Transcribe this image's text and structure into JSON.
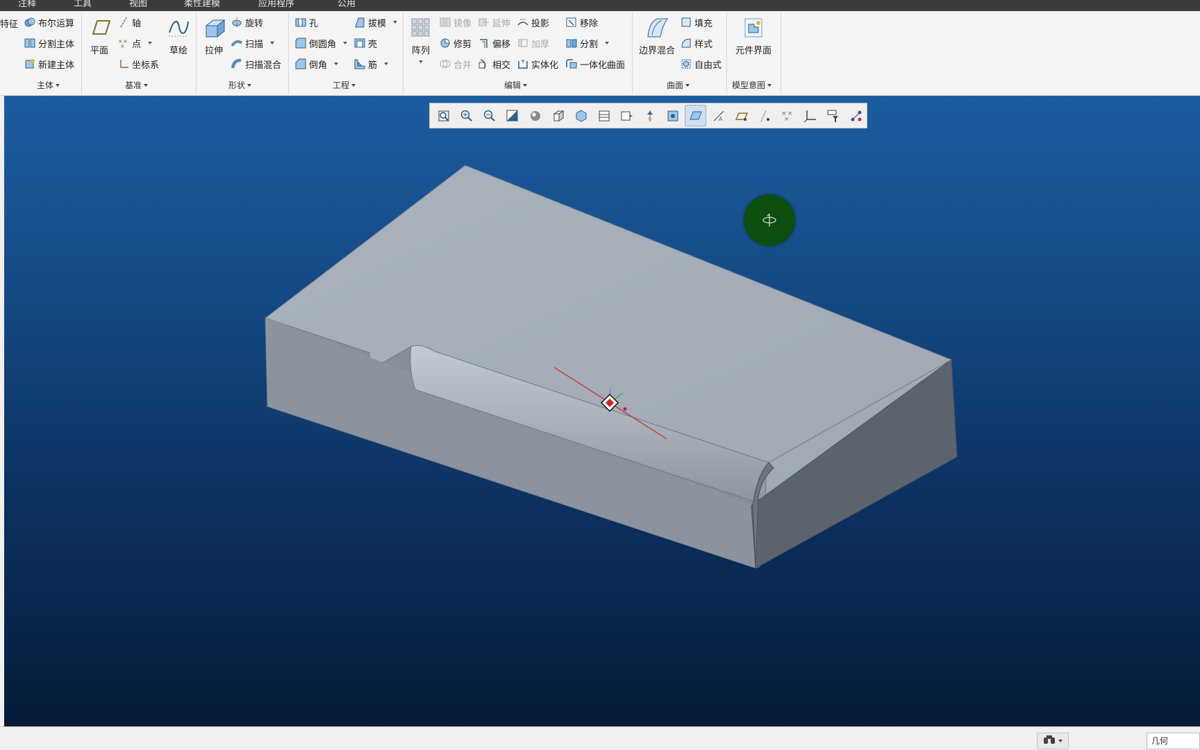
{
  "tabs": [
    "注释",
    "工具",
    "视图",
    "柔性建模",
    "应用程序",
    "公用"
  ],
  "ribbon": {
    "groups": {
      "body": {
        "label": "主体",
        "partial_edge_label": "特征",
        "items": [
          "布尔运算",
          "分割主体",
          "新建主体"
        ]
      },
      "datum": {
        "label": "基准",
        "plane": "平面",
        "axis": "轴",
        "point": "点",
        "csys": "坐标系",
        "sketch": "草绘"
      },
      "shapes": {
        "label": "形状",
        "extrude": "拉伸",
        "revolve": "旋转",
        "sweep": "扫描",
        "swept_blend": "扫描混合"
      },
      "engineering": {
        "label": "工程",
        "hole": "孔",
        "round": "倒圆角",
        "chamfer": "倒角",
        "draft": "拔模",
        "shell": "壳",
        "rib": "筋"
      },
      "editing": {
        "label": "编辑",
        "pattern": "阵列",
        "mirror": "镜像",
        "trim": "修剪",
        "merge": "合并",
        "extend": "延伸",
        "offset": "偏移",
        "intersect": "相交",
        "project": "投影",
        "thicken": "加厚",
        "solidify": "实体化",
        "remove": "移除",
        "split": "分割",
        "unify_surface": "一体化曲面"
      },
      "surfaces": {
        "label": "曲面",
        "boundary_blend": "边界混合",
        "fill": "填充",
        "style": "样式",
        "freestyle": "自由式"
      },
      "model_intent": {
        "label": "模型意图",
        "component_interface": "元件界面"
      }
    }
  },
  "graphics_toolbar": {
    "icons": [
      "refit-icon",
      "zoom-in-icon",
      "zoom-out-icon",
      "repaint-icon",
      "display-style-icon",
      "saved-orientations-icon",
      "view-manager-icon",
      "section-icon",
      "appearance-icon",
      "perspective-icon",
      "spin-center-icon",
      "annotation-display-icon",
      "datum-display-icon",
      "plane-display-icon",
      "axis-display-icon",
      "point-display-icon",
      "csys-display-icon",
      "filter-icon",
      "connections-icon"
    ],
    "active_index": 11
  },
  "status": {
    "filter_value": "几何"
  },
  "colors": {
    "viewport_top": "#1b5ca0",
    "viewport_bottom": "#061a38",
    "model_face": "#a3acb7",
    "spin_center": "#0e4e0e"
  }
}
